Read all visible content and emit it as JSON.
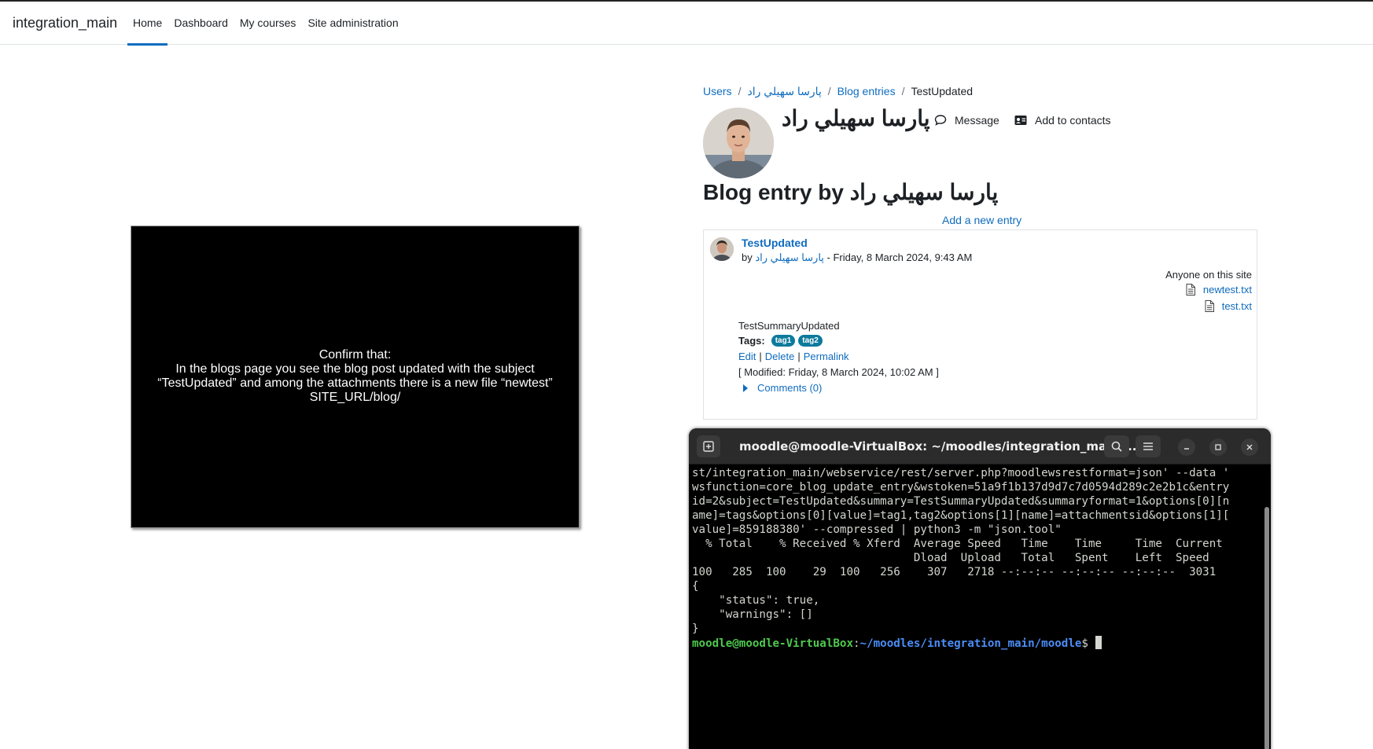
{
  "site": {
    "brand": "integration_main",
    "nav": [
      "Home",
      "Dashboard",
      "My courses",
      "Site administration"
    ]
  },
  "video": {
    "lines": [
      "Confirm that:",
      "In the blogs page you see the blog post updated with the subject",
      "“TestUpdated” and among the attachments there is a new file “newtest”",
      "SITE_URL/blog/"
    ]
  },
  "breadcrumb": [
    "Users",
    "پارسا سهيلي راد",
    "Blog entries",
    "TestUpdated"
  ],
  "profile": {
    "name": "پارسا سهيلي راد",
    "message_label": "Message",
    "contacts_label": "Add to contacts"
  },
  "heading": "Blog entry by پارسا سهيلي راد",
  "add_entry": "Add a new entry",
  "entry": {
    "subject": "TestUpdated",
    "by_prefix": "by",
    "author": "پارسا سهيلي راد",
    "date": "- Friday, 8 March 2024, 9:43 AM",
    "visibility": "Anyone on this site",
    "attachments": [
      "newtest.txt",
      "test.txt"
    ],
    "summary": "TestSummaryUpdated",
    "tags_label": "Tags:",
    "tags": [
      "tag1",
      "tag2"
    ],
    "actions": [
      "Edit",
      "Delete",
      "Permalink"
    ],
    "modified": "[ Modified: Friday, 8 March 2024, 10:02 AM ]",
    "comments": "Comments (0)"
  },
  "terminal": {
    "title": "moodle@moodle-VirtualBox: ~/moodles/integration_main/...",
    "lines": [
      "st/integration_main/webservice/rest/server.php?moodlewsrestformat=json' --data '",
      "wsfunction=core_blog_update_entry&wstoken=51a9f1b137d9d7c7d0594d289c2e2b1c&entry",
      "id=2&subject=TestUpdated&summary=TestSummaryUpdated&summaryformat=1&options[0][n",
      "ame]=tags&options[0][value]=tag1,tag2&options[1][name]=attachmentsid&options[1][",
      "value]=859188380' --compressed | python3 -m \"json.tool\"",
      "  % Total    % Received % Xferd  Average Speed   Time    Time     Time  Current",
      "                                 Dload  Upload   Total   Spent    Left  Speed",
      "100   285  100    29  100   256    307   2718 --:--:-- --:--:-- --:--:--  3031",
      "{",
      "    \"status\": true,",
      "    \"warnings\": []",
      "}"
    ],
    "prompt_user": "moodle@moodle-VirtualBox",
    "prompt_sep": ":",
    "prompt_path": "~/moodles/integration_main/moodle",
    "prompt_end": "$ "
  }
}
